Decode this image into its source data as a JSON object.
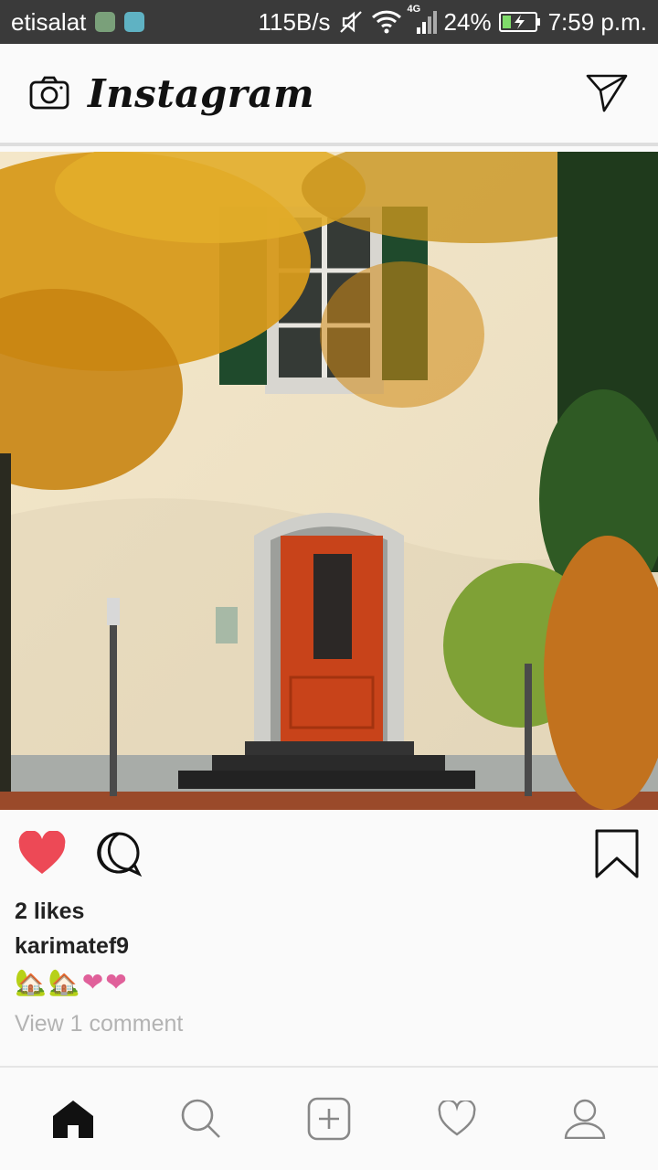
{
  "status_bar": {
    "carrier": "etisalat",
    "network_speed": "115B/s",
    "network_type": "4G",
    "battery": "24%",
    "time": "7:59 p.m."
  },
  "header": {
    "brand": "Instagram",
    "left_icon": "camera-icon",
    "right_icon": "send-icon"
  },
  "post": {
    "likes": "2 likes",
    "username": "karimatef9",
    "caption": "🏡🏡❤❤",
    "view_comments": "View 1 comment",
    "liked": true,
    "like_color": "#ed4956"
  },
  "bottom_nav": [
    "home-icon",
    "search-icon",
    "add-post-icon",
    "activity-heart-icon",
    "profile-icon"
  ]
}
